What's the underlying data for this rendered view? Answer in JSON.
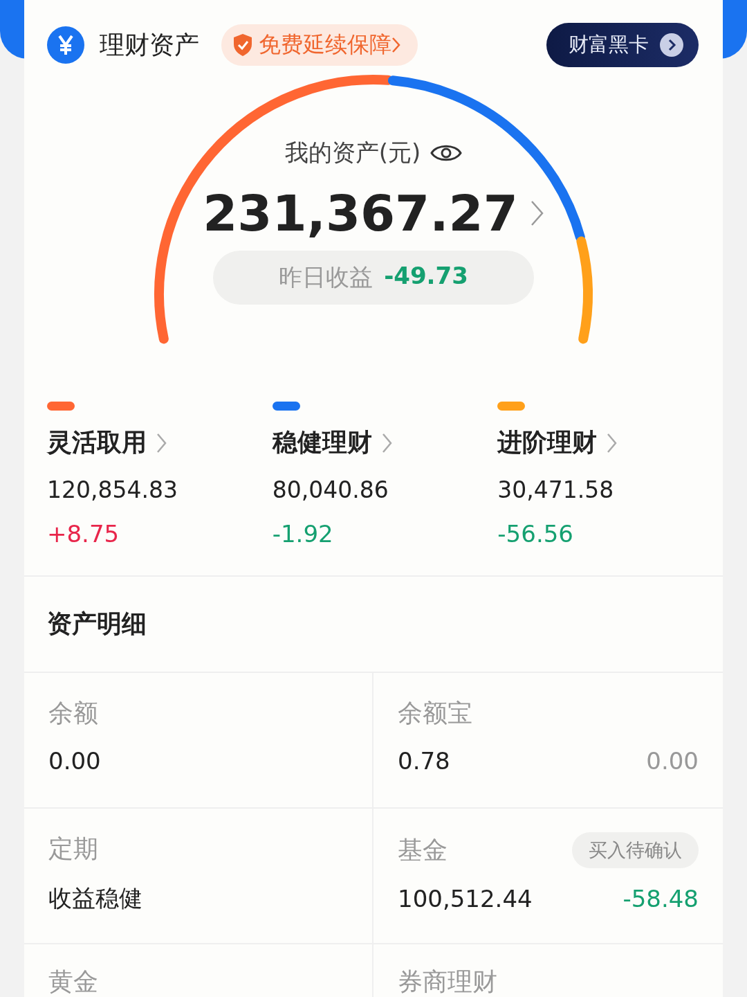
{
  "header": {
    "title": "理财资产",
    "promo": "免费延续保障",
    "vip_button": "财富黑卡"
  },
  "total": {
    "label": "我的资产(元)",
    "amount": "231,367.27",
    "yesterday_label": "昨日收益",
    "yesterday_value": "-49.73"
  },
  "categories": [
    {
      "name": "灵活取用",
      "amount": "120,854.83",
      "change": "+8.75",
      "color": "#ff6633"
    },
    {
      "name": "稳健理财",
      "amount": "80,040.86",
      "change": "-1.92",
      "color": "#1a73f0"
    },
    {
      "name": "进阶理财",
      "amount": "30,471.58",
      "change": "-56.56",
      "color": "#ffa01a"
    }
  ],
  "details": {
    "title": "资产明细",
    "items": [
      {
        "label": "余额",
        "value": "0.00"
      },
      {
        "label": "余额宝",
        "value": "0.78",
        "side": "0.00"
      },
      {
        "label": "定期",
        "value": "收益稳健"
      },
      {
        "label": "基金",
        "badge": "买入待确认",
        "value": "100,512.44",
        "side": "-58.48"
      },
      {
        "label": "黄金"
      },
      {
        "label": "券商理财"
      }
    ]
  }
}
